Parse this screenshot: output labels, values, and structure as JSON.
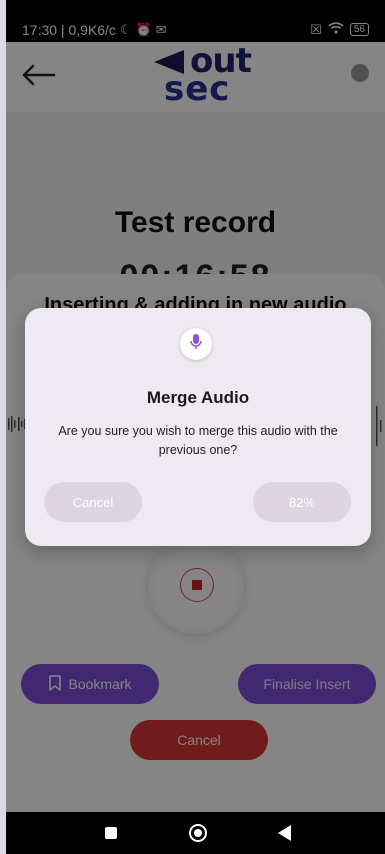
{
  "status_bar": {
    "time_speed": "17:30 | 0,9K6/c",
    "battery": "56"
  },
  "header": {
    "logo_top": "out",
    "logo_bottom": "sec"
  },
  "recording": {
    "title": "Test record",
    "time": "00:16:58"
  },
  "sheet": {
    "title": "Inserting & adding in new audio",
    "bookmark_label": "Bookmark",
    "finalise_label": "Finalise Insert",
    "cancel_label": "Cancel"
  },
  "dialog": {
    "title": "Merge Audio",
    "message": "Are you sure you wish to merge this audio with the previous one?",
    "cancel_label": "Cancel",
    "progress_label": "82%",
    "progress_value": 82
  },
  "colors": {
    "accent_purple": "#7d4ed6",
    "cancel_red": "#d73636",
    "logo_navy": "#24246e"
  }
}
